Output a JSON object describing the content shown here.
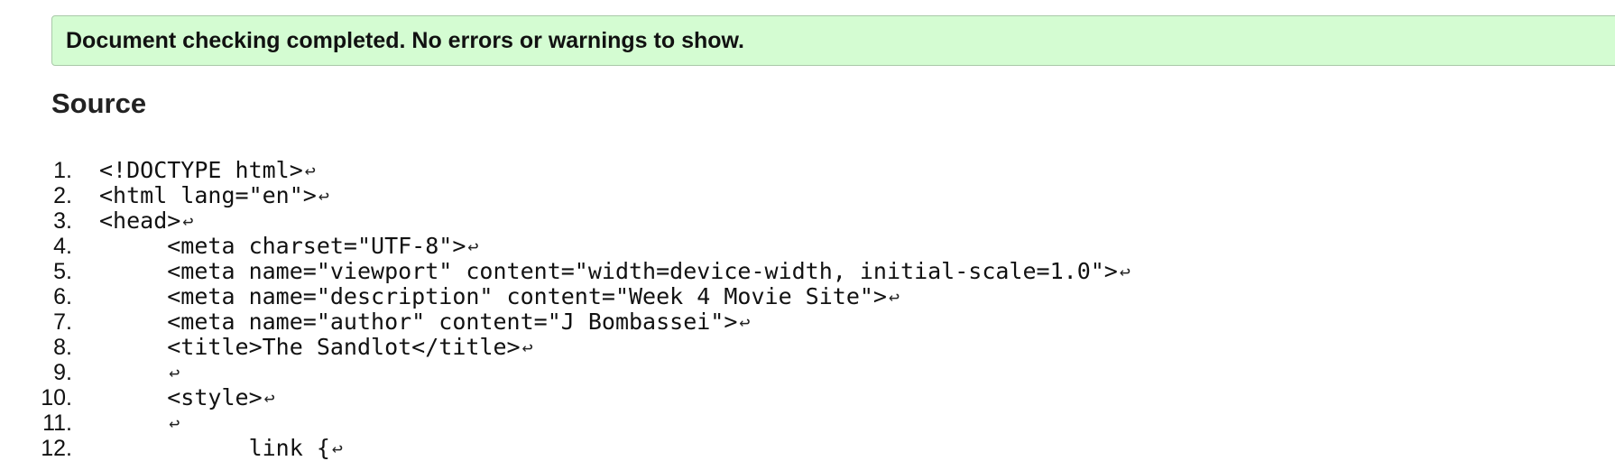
{
  "banner": {
    "message": "Document checking completed. No errors or warnings to show."
  },
  "source": {
    "heading": "Source",
    "eol_marker": "↩",
    "lines": [
      {
        "num": "1.",
        "code": "<!DOCTYPE html>"
      },
      {
        "num": "2.",
        "code": "<html lang=\"en\">"
      },
      {
        "num": "3.",
        "code": "<head>"
      },
      {
        "num": "4.",
        "code": "     <meta charset=\"UTF-8\">"
      },
      {
        "num": "5.",
        "code": "     <meta name=\"viewport\" content=\"width=device-width, initial-scale=1.0\">"
      },
      {
        "num": "6.",
        "code": "     <meta name=\"description\" content=\"Week 4 Movie Site\">"
      },
      {
        "num": "7.",
        "code": "     <meta name=\"author\" content=\"J Bombassei\">"
      },
      {
        "num": "8.",
        "code": "     <title>The Sandlot</title>"
      },
      {
        "num": "9.",
        "code": "     "
      },
      {
        "num": "10.",
        "code": "     <style>"
      },
      {
        "num": "11.",
        "code": "     "
      },
      {
        "num": "12.",
        "code": "           link {"
      }
    ]
  }
}
